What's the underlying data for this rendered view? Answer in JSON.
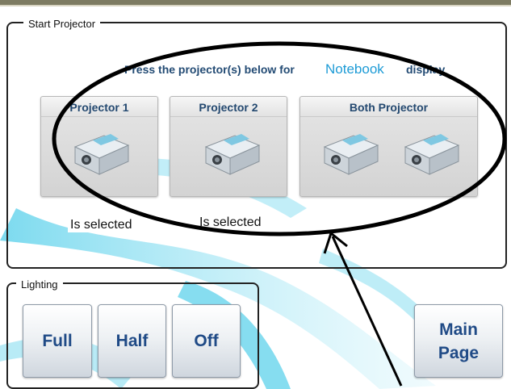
{
  "start_projector": {
    "label": "Start Projector",
    "instruction_prefix": "Press the projector(s) below for",
    "instruction_source": "Notebook",
    "instruction_suffix": "display",
    "projectors": [
      {
        "label": "Projector 1",
        "status": "Is selected"
      },
      {
        "label": "Projector 2",
        "status": "Is selected"
      },
      {
        "label": "Both Projector"
      }
    ]
  },
  "lighting": {
    "label": "Lighting",
    "buttons": [
      "Full",
      "Half",
      "Off"
    ]
  },
  "main_page_button": "Main Page",
  "colors": {
    "accent_text": "#1d9bd6",
    "button_text": "#1f4a86",
    "annotation": "#000000",
    "background_swoosh": "#35c6e6"
  }
}
